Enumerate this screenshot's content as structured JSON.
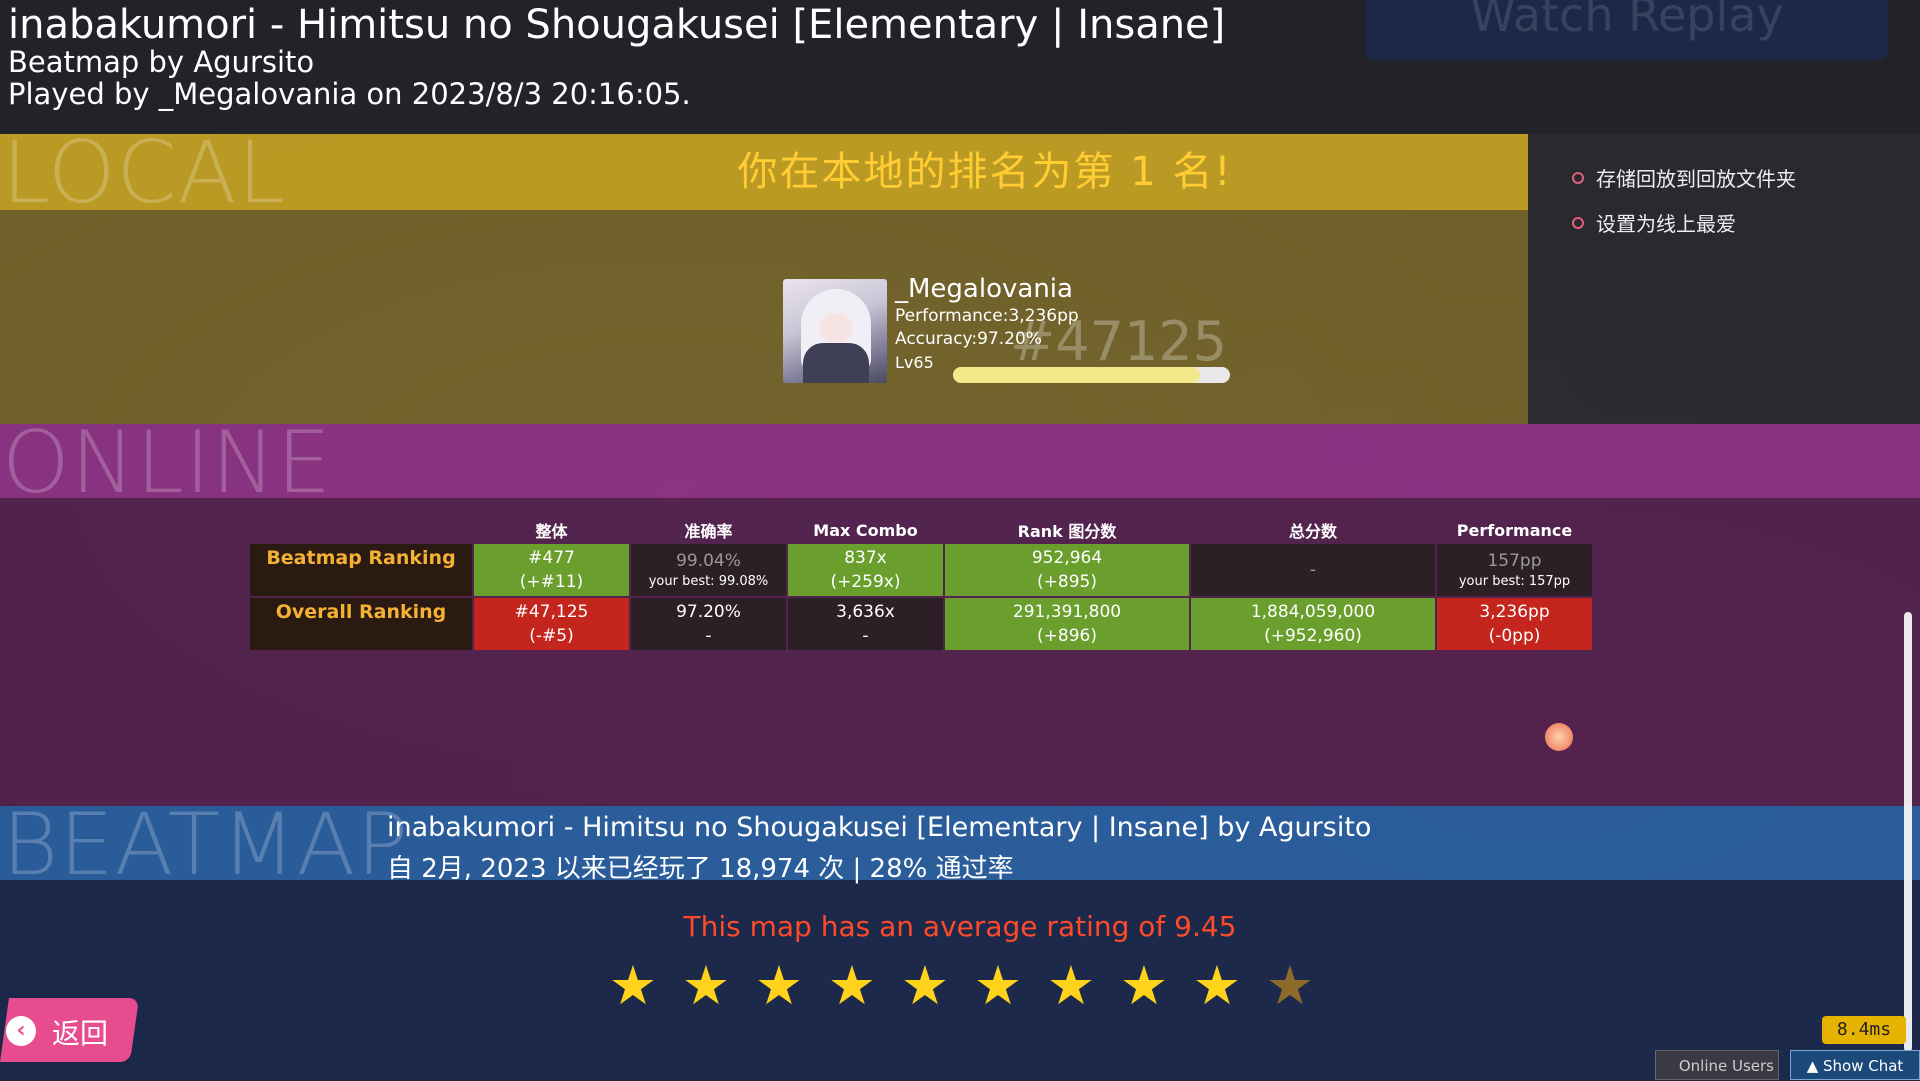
{
  "header": {
    "song_title": "inabakumori - Himitsu no Shougakusei [Elementary | Insane]",
    "mapper": "Beatmap by Agursito",
    "played_by": "Played by _Megalovania on 2023/8/3 20:16:05.",
    "watch_replay_label": "Watch Replay"
  },
  "local": {
    "section_label": "LOCAL",
    "rank_message": "你在本地的排名为第 1 名!",
    "options": [
      "存储回放到回放文件夹",
      "设置为线上最爱"
    ]
  },
  "player": {
    "name": "_Megalovania",
    "performance": "Performance:3,236pp",
    "accuracy": "Accuracy:97.20%",
    "level": "Lv65",
    "global_rank": "#47125",
    "level_progress": 0.89
  },
  "online": {
    "section_label": "ONLINE",
    "columns": [
      "",
      "整体",
      "准确率",
      "Max Combo",
      "Rank 图分数",
      "总分数",
      "Performance"
    ],
    "rows": [
      {
        "label": "Beatmap Ranking",
        "cells": [
          {
            "main": "#477",
            "sub": "(+#11)",
            "style": "green"
          },
          {
            "main": "99.04%",
            "sub": "your best: 99.08%",
            "style": "dark"
          },
          {
            "main": "837x",
            "sub": "(+259x)",
            "style": "green"
          },
          {
            "main": "952,964",
            "sub": "(+895)",
            "style": "green"
          },
          {
            "main": "-",
            "sub": "",
            "style": "dark"
          },
          {
            "main": "157pp",
            "sub": "your best: 157pp",
            "style": "dark"
          }
        ]
      },
      {
        "label": "Overall Ranking",
        "cells": [
          {
            "main": "#47,125",
            "sub": "(-#5)",
            "style": "red"
          },
          {
            "main": "97.20%",
            "sub": "-",
            "style": "dark"
          },
          {
            "main": "3,636x",
            "sub": "-",
            "style": "dark"
          },
          {
            "main": "291,391,800",
            "sub": "(+896)",
            "style": "green"
          },
          {
            "main": "1,884,059,000",
            "sub": "(+952,960)",
            "style": "green"
          },
          {
            "main": "3,236pp",
            "sub": "(-0pp)",
            "style": "red"
          }
        ]
      }
    ]
  },
  "beatmap": {
    "section_label": "BEATMAP",
    "title": "inabakumori - Himitsu no Shougakusei [Elementary | Insane] by Agursito",
    "stats": "自 2月, 2023 以来已经玩了 18,974 次 | 28% 通过率",
    "rating_text": "This map has an average rating of 9.45",
    "rating_value": 9.45,
    "rating_max": 10
  },
  "footer": {
    "back_label": "返回",
    "latency": "8.4ms",
    "online_users_label": "Online Users",
    "show_chat_label": "Show Chat"
  },
  "colors": {
    "local_banner": "#c8a523",
    "online_band": "#96328c",
    "beatmap_band": "#2864aa",
    "rank_message": "#ffcc33",
    "rating_text": "#ff4a2a",
    "star": "#ffd21c",
    "cell_green": "#6a9f2e",
    "cell_red": "#c4261e"
  }
}
